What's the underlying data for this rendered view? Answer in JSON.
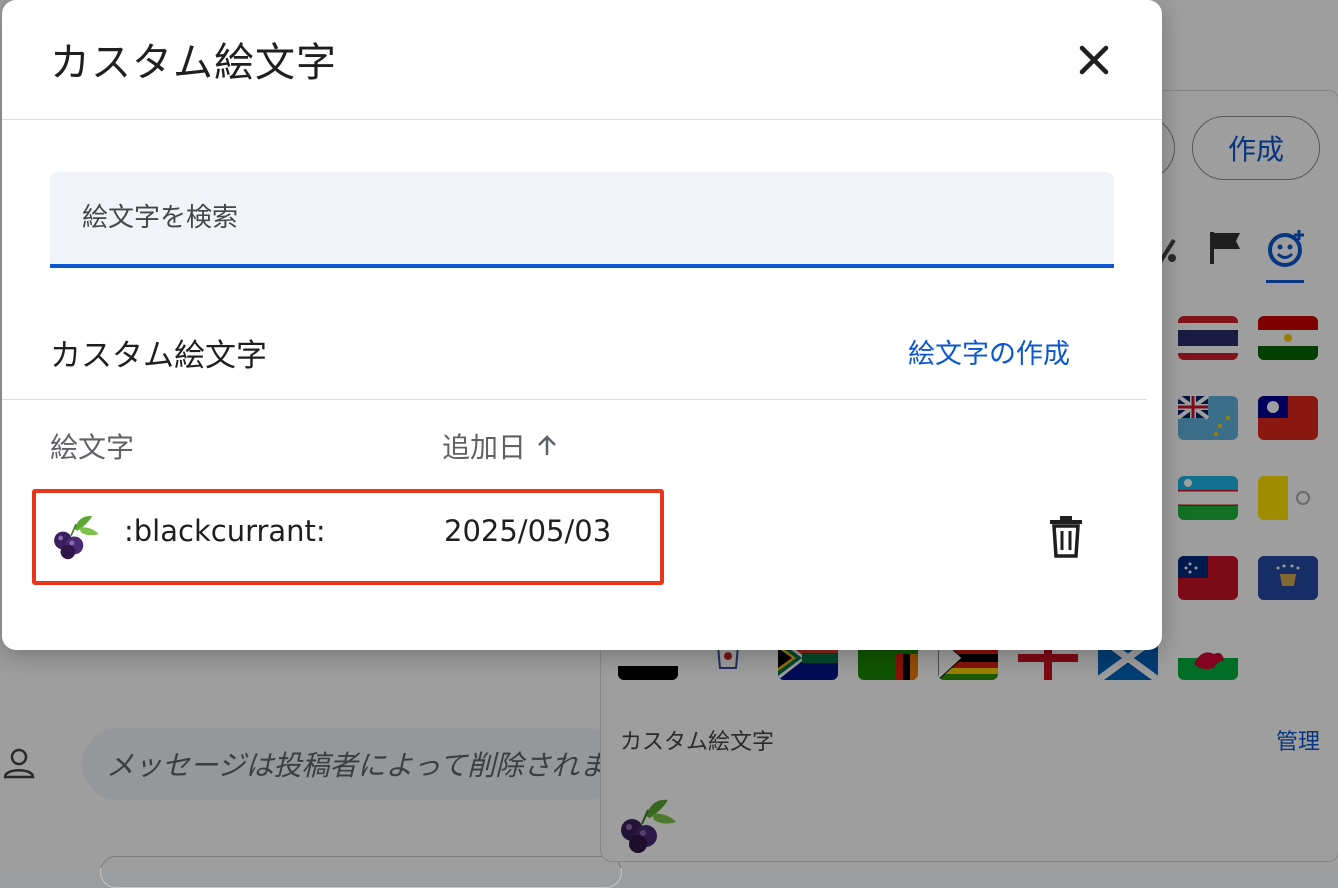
{
  "dialog": {
    "title": "カスタム絵文字",
    "search_placeholder": "絵文字を検索",
    "section_title": "カスタム絵文字",
    "create_link": "絵文字の作成",
    "columns": {
      "emoji": "絵文字",
      "added_date": "追加日"
    },
    "rows": [
      {
        "emoji_icon": "blackcurrant-icon",
        "name": ":blackcurrant:",
        "date": "2025/05/03"
      }
    ]
  },
  "background": {
    "create_button": "作成",
    "section_label": "カスタム絵文字",
    "manage_link": "管理",
    "message_text": "メッセージは投稿者によって削除されました"
  },
  "colors": {
    "accent": "#0b57d0",
    "highlight": "#e8361a",
    "text": "#1f1f1f",
    "muted": "#5f6368"
  }
}
